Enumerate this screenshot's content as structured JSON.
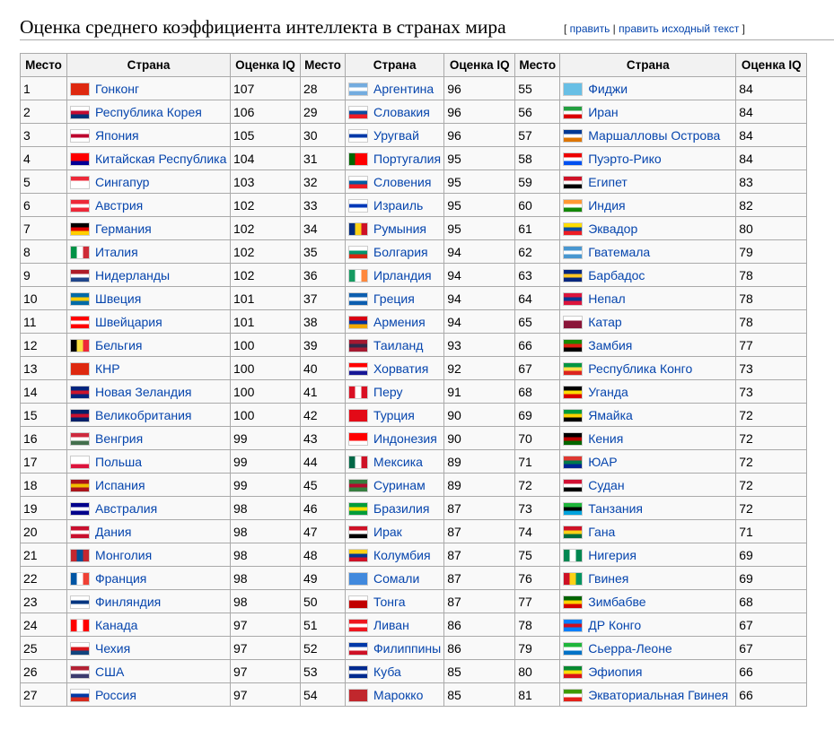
{
  "heading": {
    "title": "Оценка среднего коэффициента интеллекта в странах мира",
    "edit_open": "[ ",
    "edit_link": "править",
    "edit_sep": " | ",
    "edit_source_link": "править исходный текст",
    "edit_close": " ]"
  },
  "table": {
    "headers": [
      "Место",
      "Страна",
      "Оценка IQ",
      "Место",
      "Страна",
      "Оценка IQ",
      "Место",
      "Страна",
      "Оценка IQ"
    ],
    "rows": [
      [
        [
          "1",
          "Гонконг",
          "107",
          "hk-flag-icon"
        ],
        [
          "28",
          "Аргентина",
          "96",
          "ar-flag-icon"
        ],
        [
          "55",
          "Фиджи",
          "84",
          "fj-flag-icon"
        ]
      ],
      [
        [
          "2",
          "Республика Корея",
          "106",
          "kr-flag-icon"
        ],
        [
          "29",
          "Словакия",
          "96",
          "sk-flag-icon"
        ],
        [
          "56",
          "Иран",
          "84",
          "ir-flag-icon"
        ]
      ],
      [
        [
          "3",
          "Япония",
          "105",
          "jp-flag-icon"
        ],
        [
          "30",
          "Уругвай",
          "96",
          "uy-flag-icon"
        ],
        [
          "57",
          "Маршалловы Острова",
          "84",
          "mh-flag-icon"
        ]
      ],
      [
        [
          "4",
          "Китайская Республика",
          "104",
          "tw-flag-icon"
        ],
        [
          "31",
          "Португалия",
          "95",
          "pt-flag-icon"
        ],
        [
          "58",
          "Пуэрто-Рико",
          "84",
          "pr-flag-icon"
        ]
      ],
      [
        [
          "5",
          "Сингапур",
          "103",
          "sg-flag-icon"
        ],
        [
          "32",
          "Словения",
          "95",
          "si-flag-icon"
        ],
        [
          "59",
          "Египет",
          "83",
          "eg-flag-icon"
        ]
      ],
      [
        [
          "6",
          "Австрия",
          "102",
          "at-flag-icon"
        ],
        [
          "33",
          "Израиль",
          "95",
          "il-flag-icon"
        ],
        [
          "60",
          "Индия",
          "82",
          "in-flag-icon"
        ]
      ],
      [
        [
          "7",
          "Германия",
          "102",
          "de-flag-icon"
        ],
        [
          "34",
          "Румыния",
          "95",
          "ro-flag-icon"
        ],
        [
          "61",
          "Эквадор",
          "80",
          "ec-flag-icon"
        ]
      ],
      [
        [
          "8",
          "Италия",
          "102",
          "it-flag-icon"
        ],
        [
          "35",
          "Болгария",
          "94",
          "bg-flag-icon"
        ],
        [
          "62",
          "Гватемала",
          "79",
          "gt-flag-icon"
        ]
      ],
      [
        [
          "9",
          "Нидерланды",
          "102",
          "nl-flag-icon"
        ],
        [
          "36",
          "Ирландия",
          "94",
          "ie-flag-icon"
        ],
        [
          "63",
          "Барбадос",
          "78",
          "bb-flag-icon"
        ]
      ],
      [
        [
          "10",
          "Швеция",
          "101",
          "se-flag-icon"
        ],
        [
          "37",
          "Греция",
          "94",
          "gr-flag-icon"
        ],
        [
          "64",
          "Непал",
          "78",
          "np-flag-icon"
        ]
      ],
      [
        [
          "11",
          "Швейцария",
          "101",
          "ch-flag-icon"
        ],
        [
          "38",
          "Армения",
          "94",
          "am-flag-icon"
        ],
        [
          "65",
          "Катар",
          "78",
          "qa-flag-icon"
        ]
      ],
      [
        [
          "12",
          "Бельгия",
          "100",
          "be-flag-icon"
        ],
        [
          "39",
          "Таиланд",
          "93",
          "th-flag-icon"
        ],
        [
          "66",
          "Замбия",
          "77",
          "zm-flag-icon"
        ]
      ],
      [
        [
          "13",
          "КНР",
          "100",
          "cn-flag-icon"
        ],
        [
          "40",
          "Хорватия",
          "92",
          "hr-flag-icon"
        ],
        [
          "67",
          "Республика Конго",
          "73",
          "cg-flag-icon"
        ]
      ],
      [
        [
          "14",
          "Новая Зеландия",
          "100",
          "nz-flag-icon"
        ],
        [
          "41",
          "Перу",
          "91",
          "pe-flag-icon"
        ],
        [
          "68",
          "Уганда",
          "73",
          "ug-flag-icon"
        ]
      ],
      [
        [
          "15",
          "Великобритания",
          "100",
          "gb-flag-icon"
        ],
        [
          "42",
          "Турция",
          "90",
          "tr-flag-icon"
        ],
        [
          "69",
          "Ямайка",
          "72",
          "jm-flag-icon"
        ]
      ],
      [
        [
          "16",
          "Венгрия",
          "99",
          "hu-flag-icon"
        ],
        [
          "43",
          "Индонезия",
          "90",
          "id-flag-icon"
        ],
        [
          "70",
          "Кения",
          "72",
          "ke-flag-icon"
        ]
      ],
      [
        [
          "17",
          "Польша",
          "99",
          "pl-flag-icon"
        ],
        [
          "44",
          "Мексика",
          "89",
          "mx-flag-icon"
        ],
        [
          "71",
          "ЮАР",
          "72",
          "za-flag-icon"
        ]
      ],
      [
        [
          "18",
          "Испания",
          "99",
          "es-flag-icon"
        ],
        [
          "45",
          "Суринам",
          "89",
          "sr-flag-icon"
        ],
        [
          "72",
          "Судан",
          "72",
          "sd-flag-icon"
        ]
      ],
      [
        [
          "19",
          "Австралия",
          "98",
          "au-flag-icon"
        ],
        [
          "46",
          "Бразилия",
          "87",
          "br-flag-icon"
        ],
        [
          "73",
          "Танзания",
          "72",
          "tz-flag-icon"
        ]
      ],
      [
        [
          "20",
          "Дания",
          "98",
          "dk-flag-icon"
        ],
        [
          "47",
          "Ирак",
          "87",
          "iq-flag-icon"
        ],
        [
          "74",
          "Гана",
          "71",
          "gh-flag-icon"
        ]
      ],
      [
        [
          "21",
          "Монголия",
          "98",
          "mn-flag-icon"
        ],
        [
          "48",
          "Колумбия",
          "87",
          "co-flag-icon"
        ],
        [
          "75",
          "Нигерия",
          "69",
          "ng-flag-icon"
        ]
      ],
      [
        [
          "22",
          "Франция",
          "98",
          "fr-flag-icon"
        ],
        [
          "49",
          "Сомали",
          "87",
          "so-flag-icon"
        ],
        [
          "76",
          "Гвинея",
          "69",
          "gn-flag-icon"
        ]
      ],
      [
        [
          "23",
          "Финляндия",
          "98",
          "fi-flag-icon"
        ],
        [
          "50",
          "Тонга",
          "87",
          "to-flag-icon"
        ],
        [
          "77",
          "Зимбабве",
          "68",
          "zw-flag-icon"
        ]
      ],
      [
        [
          "24",
          "Канада",
          "97",
          "ca-flag-icon"
        ],
        [
          "51",
          "Ливан",
          "86",
          "lb-flag-icon"
        ],
        [
          "78",
          "ДР Конго",
          "67",
          "cd-flag-icon"
        ]
      ],
      [
        [
          "25",
          "Чехия",
          "97",
          "cz-flag-icon"
        ],
        [
          "52",
          "Филиппины",
          "86",
          "ph-flag-icon"
        ],
        [
          "79",
          "Сьерра-Леоне",
          "67",
          "sl-flag-icon"
        ]
      ],
      [
        [
          "26",
          "США",
          "97",
          "us-flag-icon"
        ],
        [
          "53",
          "Куба",
          "85",
          "cu-flag-icon"
        ],
        [
          "80",
          "Эфиопия",
          "66",
          "et-flag-icon"
        ]
      ],
      [
        [
          "27",
          "Россия",
          "97",
          "ru-flag-icon"
        ],
        [
          "54",
          "Марокко",
          "85",
          "ma-flag-icon"
        ],
        [
          "81",
          "Экваториальная Гвинея",
          "66",
          "gq-flag-icon"
        ]
      ]
    ]
  },
  "flag_colors": {
    "hk": [
      "#de2910",
      "#de2910",
      "#de2910"
    ],
    "kr": [
      "#ffffff",
      "#c60c30",
      "#003478"
    ],
    "jp": [
      "#ffffff",
      "#bc002d",
      "#ffffff"
    ],
    "tw": [
      "#fe0000",
      "#fe0000",
      "#000095"
    ],
    "sg": [
      "#ed2939",
      "#ffffff",
      "#ffffff"
    ],
    "at": [
      "#ed2939",
      "#ffffff",
      "#ed2939"
    ],
    "de": [
      "#000000",
      "#dd0000",
      "#ffce00"
    ],
    "it": [
      "#009246",
      "#ffffff",
      "#ce2b37"
    ],
    "nl": [
      "#ae1c28",
      "#ffffff",
      "#21468b"
    ],
    "se": [
      "#006aa7",
      "#fecc00",
      "#006aa7"
    ],
    "ch": [
      "#ff0000",
      "#ffffff",
      "#ff0000"
    ],
    "be": [
      "#000000",
      "#fae042",
      "#ed2939"
    ],
    "cn": [
      "#de2910",
      "#de2910",
      "#de2910"
    ],
    "nz": [
      "#00247d",
      "#cc142b",
      "#00247d"
    ],
    "gb": [
      "#012169",
      "#c8102e",
      "#012169"
    ],
    "hu": [
      "#cd2a3e",
      "#ffffff",
      "#436f4d"
    ],
    "pl": [
      "#ffffff",
      "#ffffff",
      "#dc143c"
    ],
    "es": [
      "#aa151b",
      "#f1bf00",
      "#aa151b"
    ],
    "au": [
      "#00008b",
      "#ffffff",
      "#00008b"
    ],
    "dk": [
      "#c8102e",
      "#ffffff",
      "#c8102e"
    ],
    "mn": [
      "#c4272f",
      "#015197",
      "#c4272f"
    ],
    "fr": [
      "#0055a4",
      "#ffffff",
      "#ef4135"
    ],
    "fi": [
      "#ffffff",
      "#003580",
      "#ffffff"
    ],
    "ca": [
      "#ff0000",
      "#ffffff",
      "#ff0000"
    ],
    "cz": [
      "#ffffff",
      "#d7141a",
      "#11457e"
    ],
    "us": [
      "#b22234",
      "#ffffff",
      "#3c3b6e"
    ],
    "ru": [
      "#ffffff",
      "#0039a6",
      "#d52b1e"
    ],
    "ar": [
      "#74acdf",
      "#ffffff",
      "#74acdf"
    ],
    "sk": [
      "#ffffff",
      "#0b4ea2",
      "#ee1c25"
    ],
    "uy": [
      "#ffffff",
      "#0038a8",
      "#ffffff"
    ],
    "pt": [
      "#006600",
      "#ff0000",
      "#ff0000"
    ],
    "si": [
      "#ffffff",
      "#005da4",
      "#ed1c24"
    ],
    "il": [
      "#ffffff",
      "#0038b8",
      "#ffffff"
    ],
    "ro": [
      "#002b7f",
      "#fcd116",
      "#ce1126"
    ],
    "bg": [
      "#ffffff",
      "#00966e",
      "#d62612"
    ],
    "ie": [
      "#169b62",
      "#ffffff",
      "#ff883e"
    ],
    "gr": [
      "#0d5eaf",
      "#ffffff",
      "#0d5eaf"
    ],
    "am": [
      "#d90012",
      "#0033a0",
      "#f2a800"
    ],
    "th": [
      "#a51931",
      "#2d2a4a",
      "#a51931"
    ],
    "hr": [
      "#ff0000",
      "#ffffff",
      "#171796"
    ],
    "pe": [
      "#d91023",
      "#ffffff",
      "#d91023"
    ],
    "tr": [
      "#e30a17",
      "#e30a17",
      "#e30a17"
    ],
    "id": [
      "#ff0000",
      "#ff0000",
      "#ffffff"
    ],
    "mx": [
      "#006847",
      "#ffffff",
      "#ce1126"
    ],
    "sr": [
      "#377e3f",
      "#b40a2d",
      "#377e3f"
    ],
    "br": [
      "#009c3b",
      "#ffdf00",
      "#009c3b"
    ],
    "iq": [
      "#ce1126",
      "#ffffff",
      "#000000"
    ],
    "co": [
      "#fcd116",
      "#003893",
      "#ce1126"
    ],
    "so": [
      "#4189dd",
      "#4189dd",
      "#4189dd"
    ],
    "to": [
      "#ffffff",
      "#c10000",
      "#c10000"
    ],
    "lb": [
      "#ee161f",
      "#ffffff",
      "#ee161f"
    ],
    "ph": [
      "#0038a8",
      "#ffffff",
      "#ce1126"
    ],
    "cu": [
      "#002a8f",
      "#ffffff",
      "#002a8f"
    ],
    "ma": [
      "#c1272d",
      "#c1272d",
      "#c1272d"
    ],
    "fj": [
      "#68bfe5",
      "#68bfe5",
      "#68bfe5"
    ],
    "ir": [
      "#239f40",
      "#ffffff",
      "#da0000"
    ],
    "mh": [
      "#003893",
      "#ffffff",
      "#dd7500"
    ],
    "pr": [
      "#ed0000",
      "#ffffff",
      "#0050f0"
    ],
    "eg": [
      "#ce1126",
      "#ffffff",
      "#000000"
    ],
    "in": [
      "#ff9933",
      "#ffffff",
      "#138808"
    ],
    "ec": [
      "#ffdd00",
      "#034ea2",
      "#ed1c24"
    ],
    "gt": [
      "#4997d0",
      "#ffffff",
      "#4997d0"
    ],
    "bb": [
      "#00267f",
      "#ffc726",
      "#00267f"
    ],
    "np": [
      "#dc143c",
      "#003893",
      "#dc143c"
    ],
    "qa": [
      "#ffffff",
      "#8a1538",
      "#8a1538"
    ],
    "zm": [
      "#198a00",
      "#de2010",
      "#000000"
    ],
    "cg": [
      "#009543",
      "#fbde4a",
      "#dc241f"
    ],
    "ug": [
      "#000000",
      "#fcdc04",
      "#d90000"
    ],
    "jm": [
      "#009b3a",
      "#fed100",
      "#000000"
    ],
    "ke": [
      "#000000",
      "#bb0000",
      "#006600"
    ],
    "za": [
      "#de3831",
      "#007a4d",
      "#002395"
    ],
    "sd": [
      "#d21034",
      "#ffffff",
      "#000000"
    ],
    "tz": [
      "#1eb53a",
      "#000000",
      "#00a3dd"
    ],
    "gh": [
      "#ce1126",
      "#fcd116",
      "#006b3f"
    ],
    "ng": [
      "#008751",
      "#ffffff",
      "#008751"
    ],
    "gn": [
      "#ce1126",
      "#fcd116",
      "#009460"
    ],
    "zw": [
      "#006400",
      "#ffd200",
      "#d40000"
    ],
    "cd": [
      "#007fff",
      "#ce1021",
      "#007fff"
    ],
    "sl": [
      "#1eb53a",
      "#ffffff",
      "#0072c6"
    ],
    "et": [
      "#078930",
      "#fcdd09",
      "#da121a"
    ],
    "gq": [
      "#3e9a00",
      "#ffffff",
      "#e32118"
    ]
  },
  "flag_layout": {
    "vertical": [
      "it",
      "fr",
      "be",
      "ie",
      "ro",
      "ng",
      "gn",
      "mx",
      "ca",
      "pe",
      "ma",
      "mn",
      "pt",
      "ae"
    ],
    "horizontal_default": true
  }
}
